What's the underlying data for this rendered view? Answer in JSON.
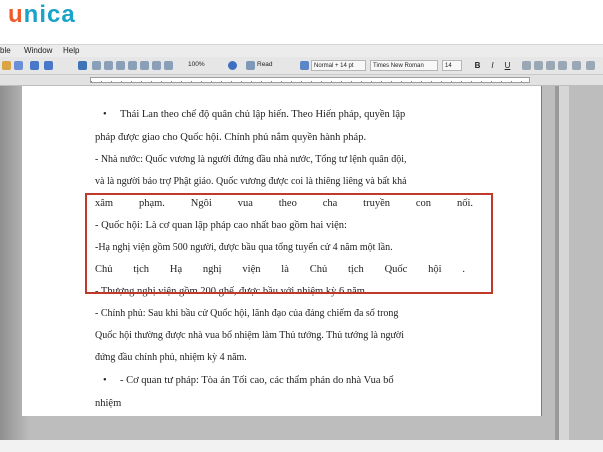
{
  "brand": {
    "logo_prefix": "u",
    "logo_rest": "nica"
  },
  "menu": {
    "items": [
      "ble",
      "Window",
      "Help"
    ]
  },
  "toolbar": {
    "zoom": "100%",
    "read_label": "Read",
    "style": "Normal + 14 pt",
    "font": "Times New Roman",
    "size": "14",
    "bold": "B",
    "italic": "I",
    "underline": "U"
  },
  "document": {
    "lines": [
      "Thái Lan theo chế độ quân chủ lập hiến. Theo Hiến pháp, quyền lập",
      "pháp được giao cho Quốc hội. Chính phủ nắm quyền hành pháp.",
      "- Nhà nước: Quốc vương là người đứng đầu nhà nước, Tổng tư lệnh quân đội,",
      "và là người bảo trợ Phật giáo. Quốc vương được coi là thiêng liêng và bất khả",
      "xâm phạm. Ngôi vua theo cha truyền con nối.",
      "- Quốc hội: Là cơ quan lập pháp cao nhất bao gồm hai viện:",
      "-Hạ nghị viện gồm 500 người, được bầu qua tổng tuyển cử 4 năm một lần.",
      "Chủ tịch Hạ nghị viện là Chủ tịch Quốc hội .",
      "- Thượng nghị viện gồm 200 ghế, được bầu với nhiệm kỳ 6 năm.",
      "- Chính phủ: Sau khi bầu cử Quốc hội, lãnh đạo của đảng chiếm đa số trong",
      "Quốc hội thường được nhà vua bổ nhiệm làm Thủ tướng. Thủ tướng là người",
      "đứng đầu chính phủ, nhiệm kỳ 4 năm.",
      "- Cơ quan tư pháp: Tòa án Tối cao, các thẩm phán do nhà Vua bổ",
      "nhiệm"
    ],
    "bullet": "•"
  }
}
